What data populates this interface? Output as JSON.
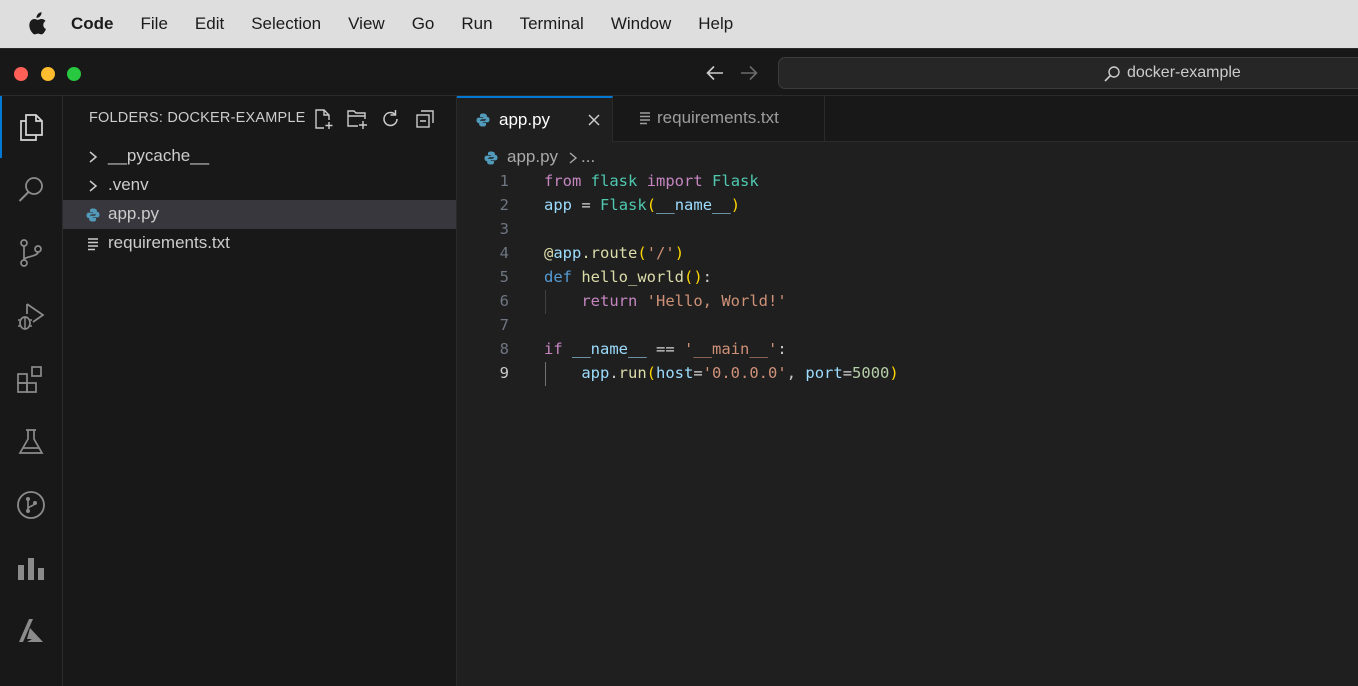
{
  "menubar": {
    "app": "Code",
    "items": [
      "File",
      "Edit",
      "Selection",
      "View",
      "Go",
      "Run",
      "Terminal",
      "Window",
      "Help"
    ]
  },
  "titlebar": {
    "command_center": "docker-example"
  },
  "activity_bar": {
    "icons": [
      "explorer-icon",
      "search-icon",
      "source-control-icon",
      "run-debug-icon",
      "extensions-icon",
      "testing-icon",
      "git-graph-icon",
      "stats-icon",
      "azure-icon"
    ],
    "active": "explorer-icon"
  },
  "sidebar": {
    "title": "FOLDERS: DOCKER-EXAMPLE",
    "actions": [
      "new-file-icon",
      "new-folder-icon",
      "refresh-icon",
      "collapse-all-icon"
    ],
    "items": [
      {
        "label": "__pycache__",
        "kind": "folder"
      },
      {
        "label": ".venv",
        "kind": "folder"
      },
      {
        "label": "app.py",
        "kind": "python",
        "selected": true
      },
      {
        "label": "requirements.txt",
        "kind": "text"
      }
    ]
  },
  "tabs": [
    {
      "label": "app.py",
      "active": true
    },
    {
      "label": "requirements.txt",
      "active": false
    }
  ],
  "breadcrumb": {
    "file": "app.py",
    "rest": "..."
  },
  "code": {
    "current_line": 9,
    "lines": [
      {
        "n": "1",
        "text": "from flask import Flask"
      },
      {
        "n": "2",
        "text": "app = Flask(__name__)"
      },
      {
        "n": "3",
        "text": ""
      },
      {
        "n": "4",
        "text": "@app.route('/')"
      },
      {
        "n": "5",
        "text": "def hello_world():"
      },
      {
        "n": "6",
        "text": "    return 'Hello, World!'"
      },
      {
        "n": "7",
        "text": ""
      },
      {
        "n": "8",
        "text": "if __name__ == '__main__':"
      },
      {
        "n": "9",
        "text": "    app.run(host='0.0.0.0', port=5000)"
      }
    ]
  },
  "colors": {
    "accent": "#0078d4",
    "keyword": "#c586c0",
    "def_keyword": "#569cd6",
    "class": "#4ec9b0",
    "function": "#dcdcaa",
    "variable": "#9cdcfe",
    "string": "#ce9178",
    "number": "#b5cea8"
  }
}
